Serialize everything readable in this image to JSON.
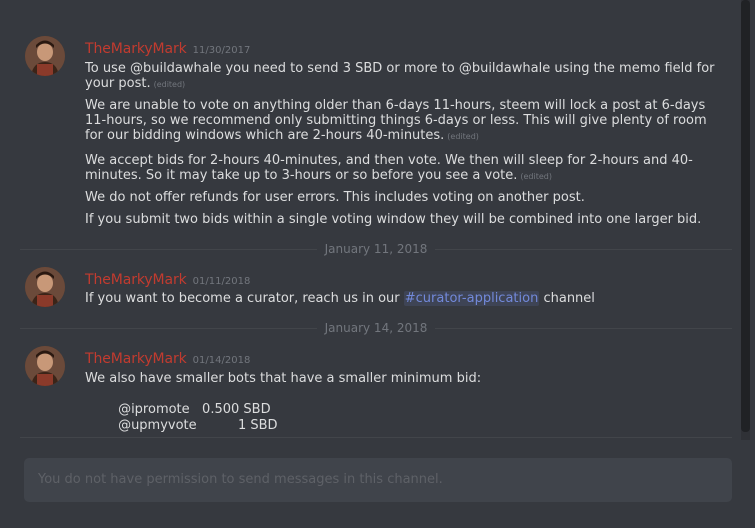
{
  "messages": [
    {
      "username": "TheMarkyMark",
      "timestamp": "11/30/2017",
      "lines": [
        {
          "text": "To use @buildawhale you need to send 3 SBD or more to @buildawhale using the memo field for your post.",
          "edited": "(edited)"
        },
        {
          "text": "We are unable to vote on anything older than 6-days 11-hours, steem will lock a post at 6-days 11-hours, so we recommend only submitting things 6-days or less.  This will give plenty of  room for our bidding windows which are 2-hours 40-minutes.",
          "edited": "(edited)"
        },
        {
          "text": "We accept bids for 2-hours 40-minutes, and then vote.   We then will sleep for 2-hours and 40-minutes.  So it may take up to 3-hours or so before you see a vote.",
          "edited": "(edited)"
        },
        {
          "text": "We do not offer refunds for user errors.  This includes voting on another post.",
          "edited": ""
        },
        {
          "text": "If you submit two bids within a single voting window they will be combined into one larger bid.",
          "edited": ""
        }
      ]
    },
    {
      "username": "TheMarkyMark",
      "timestamp": "01/11/2018",
      "line_prefix": "If you want to become a curator, reach us in our ",
      "channel_mention": "#curator-application",
      "line_suffix": " channel"
    },
    {
      "username": "TheMarkyMark",
      "timestamp": "01/14/2018",
      "lines": [
        {
          "text": "We also have smaller bots that have a smaller minimum bid:"
        },
        {
          "text": "@ipromote   0.500 SBD"
        },
        {
          "text": "@upmyvote          1 SBD"
        }
      ]
    }
  ],
  "dividers": [
    "January 11, 2018",
    "January 14, 2018"
  ],
  "input": {
    "placeholder": "You do not have permission to send messages in this channel."
  },
  "colors": {
    "background": "#36393f",
    "username": "#c23b2f",
    "mention": "#7289da"
  }
}
